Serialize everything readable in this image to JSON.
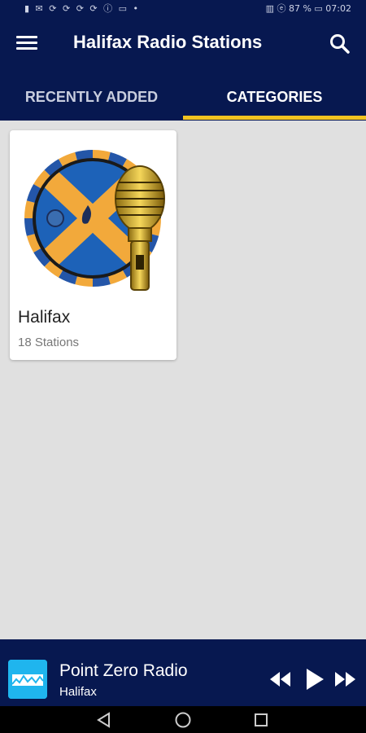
{
  "status_bar": {
    "left_icons": "▮ ✉ ⟳ ⟳ ⟳ ⟳ ⓘ ▭ •",
    "right_text": "▥ ⓔ 87 % ▭ 07:02"
  },
  "app_bar": {
    "title": "Halifax Radio Stations",
    "menu_icon": "hamburger-icon",
    "search_icon": "search-icon"
  },
  "tabs": [
    {
      "label": "RECENTLY ADDED",
      "selected": false
    },
    {
      "label": "CATEGORIES",
      "selected": true
    }
  ],
  "categories": [
    {
      "name": "Halifax",
      "subtitle": "18 Stations"
    }
  ],
  "player": {
    "title": "Point Zero Radio",
    "subtitle": "Halifax",
    "controls": [
      "rewind-icon",
      "play-icon",
      "fast-forward-icon"
    ]
  },
  "nav_bar": [
    "back-icon",
    "home-icon",
    "recents-icon"
  ],
  "colors": {
    "primary": "#071850",
    "accent": "#f2c320",
    "background": "#e0e0e0",
    "thumb": "#1fb5ee"
  }
}
